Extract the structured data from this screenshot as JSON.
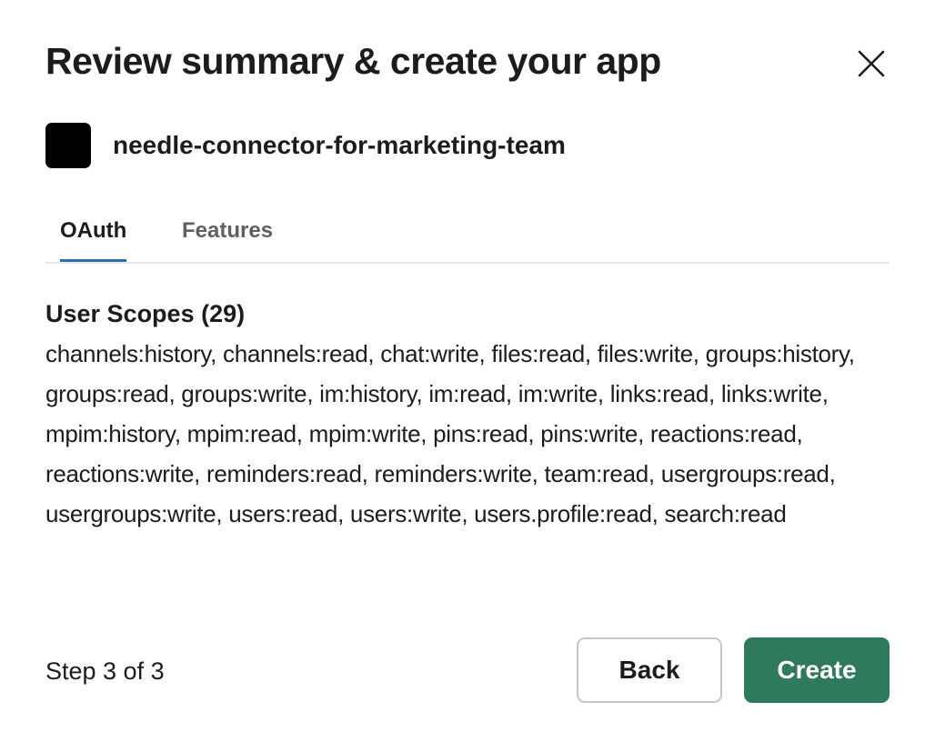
{
  "dialog": {
    "title": "Review summary & create your app",
    "close_icon": "close-icon"
  },
  "app": {
    "name": "needle-connector-for-marketing-team",
    "icon_color": "#000000"
  },
  "tabs": [
    {
      "label": "OAuth",
      "selected": true
    },
    {
      "label": "Features",
      "selected": false
    }
  ],
  "scopes": {
    "heading": "User Scopes (29)",
    "list": "channels:history, channels:read, chat:write, files:read, files:write, groups:history, groups:read, groups:write, im:history, im:read, im:write, links:read, links:write, mpim:history, mpim:read, mpim:write, pins:read, pins:write, reactions:read, reactions:write, reminders:read, reminders:write, team:read, usergroups:read, usergroups:write, users:read, users:write, users.profile:read, search:read"
  },
  "footer": {
    "step": "Step 3 of 3",
    "back_label": "Back",
    "create_label": "Create"
  },
  "colors": {
    "accent_tab": "#2a6fa8",
    "create_button": "#2f7a5c"
  }
}
